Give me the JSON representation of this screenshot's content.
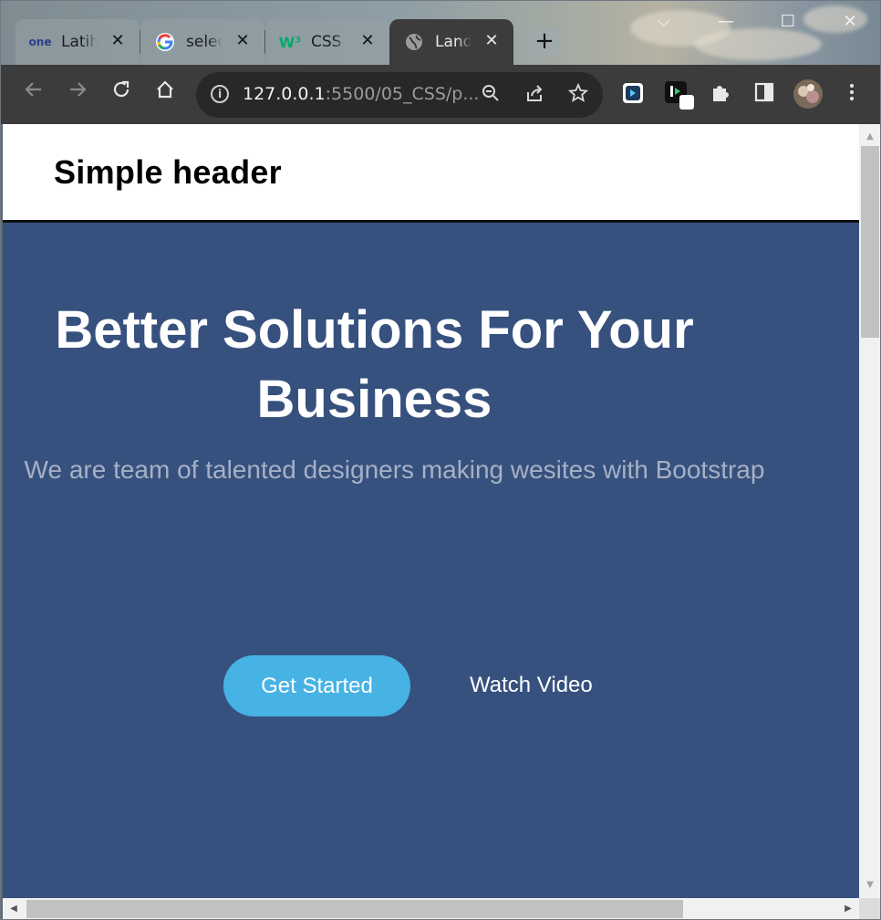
{
  "browser": {
    "tabs": [
      {
        "title": "Latihan",
        "favicon": "one-logo-icon",
        "state": "inactive"
      },
      {
        "title": "select",
        "favicon": "google-icon",
        "state": "inactive"
      },
      {
        "title": "CSS Selectors",
        "favicon": "w3schools-icon",
        "state": "inactive"
      },
      {
        "title": "Landing",
        "favicon": "globe-icon",
        "state": "active"
      }
    ],
    "close_glyph": "✕",
    "new_tab_glyph": "+",
    "window_controls": {
      "dropdown": "⌵",
      "minimize": "—",
      "maximize": "☐",
      "close": "✕"
    },
    "address": {
      "host": "127.0.0.1",
      "rest": ":5500/05_CSS/p..."
    },
    "toolbar_icons": [
      "back-icon",
      "forward-icon",
      "reload-icon",
      "home-icon",
      "site-info-icon",
      "zoom-icon",
      "share-icon",
      "bookmark-star-icon",
      "extension-icon",
      "extension-icon",
      "puzzle-icon",
      "side-panel-icon",
      "profile-avatar",
      "menu-icon"
    ]
  },
  "page": {
    "header_title": "Simple header",
    "hero": {
      "heading": "Better Solutions For Your Business",
      "subheading": "We are team of talented designers making wesites with Bootstrap",
      "primary_button": "Get Started",
      "secondary_button": "Watch Video"
    }
  },
  "colors": {
    "hero_bg": "#37517e",
    "accent": "#47b2e4",
    "subtext": "#a6b0c5"
  }
}
